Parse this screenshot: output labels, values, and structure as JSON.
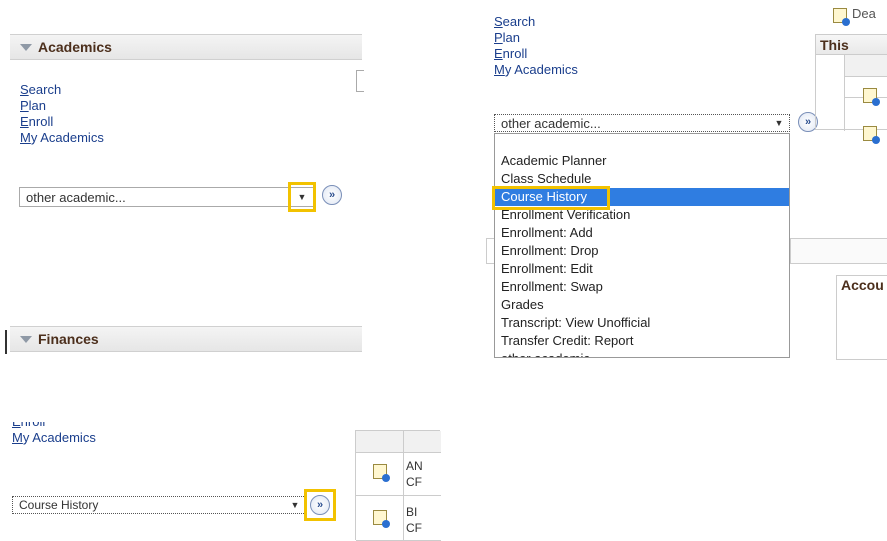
{
  "panel1": {
    "academics_header": "Academics",
    "links": [
      {
        "first": "S",
        "rest": "earch"
      },
      {
        "first": "P",
        "rest": "lan"
      },
      {
        "first": "E",
        "rest": "nroll"
      },
      {
        "first": "M",
        "rest": "y Academics"
      }
    ],
    "select_value": "other academic...",
    "finances_header": "Finances"
  },
  "panel2": {
    "links": [
      {
        "first": "S",
        "rest": "earch"
      },
      {
        "first": "P",
        "rest": "lan"
      },
      {
        "first": "E",
        "rest": "nroll"
      },
      {
        "first": "M",
        "rest": "y Academics"
      }
    ],
    "select_value": "other academic...",
    "dropdown_options": [
      "Academic Planner",
      "Class Schedule",
      "Course History",
      "Enrollment Verification",
      "Enrollment: Add",
      "Enrollment: Drop",
      "Enrollment: Edit",
      "Enrollment: Swap",
      "Grades",
      "Transcript: View Unofficial",
      "Transfer Credit: Report",
      "other academic..."
    ],
    "selected_option": "Course History",
    "right_top_text": "Dea",
    "this_header": "This",
    "accou_header": "Accou"
  },
  "panel3": {
    "links": [
      {
        "first": "E",
        "rest": "nroll"
      },
      {
        "first": "M",
        "rest": "y Academics"
      }
    ],
    "select_value": "Course History",
    "rows": [
      {
        "line1": "AN",
        "line2": "CF"
      },
      {
        "line1": "BI",
        "line2": "CF"
      }
    ]
  },
  "colors": {
    "highlight": "#f2c200",
    "selected_bg": "#2f7de1",
    "link": "#1a3e8c",
    "header_text": "#4c2f1c"
  }
}
